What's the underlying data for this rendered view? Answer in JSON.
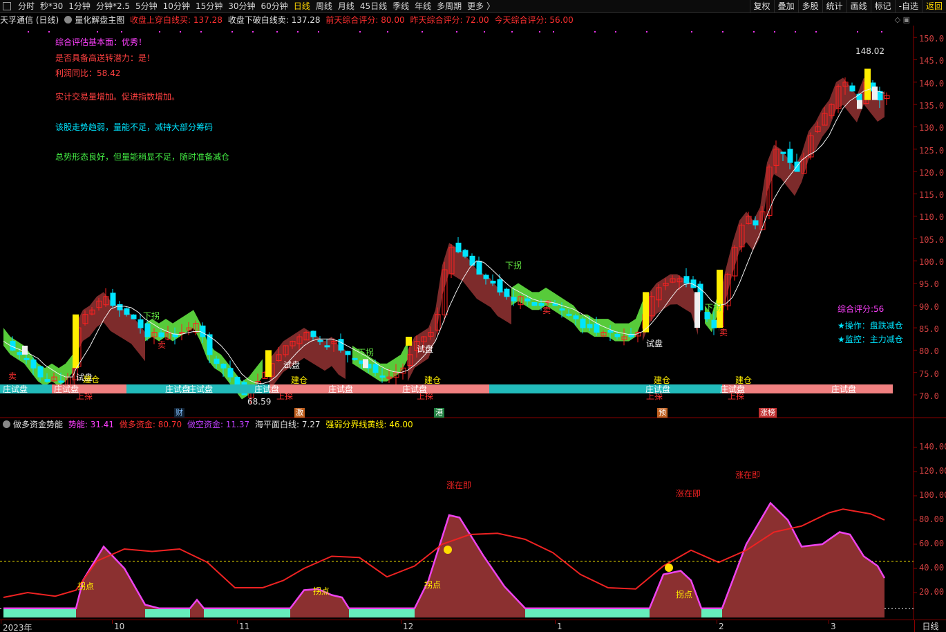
{
  "toolbar": {
    "periods": [
      "分时",
      "秒*30",
      "1分钟",
      "分钟*2.5",
      "5分钟",
      "10分钟",
      "15分钟",
      "30分钟",
      "60分钟",
      "日线",
      "周线",
      "月线",
      "45日线",
      "季线",
      "年线",
      "多周期",
      "更多 〉"
    ],
    "active_period": "日线",
    "tools": [
      "复权",
      "叠加",
      "多股",
      "统计",
      "画线",
      "标记",
      "-自选",
      "返回"
    ]
  },
  "info_bar": {
    "stock": "天孚通信 (日线)",
    "indicator": "量化解盘主图",
    "item1": "收盘上穿白线买: 137.28",
    "item2": "收盘下破白线卖: 137.28",
    "item3": "前天综合评分: 80.00",
    "item4": "昨天综合评分: 72.00",
    "item5": "今天综合评分: 56.00"
  },
  "analysis": {
    "line1": "综合评估基本面：优秀！",
    "line2": "是否具备高送转潜力：是！",
    "line3": "利润同比：58.42",
    "line4": "实计交易量增加。促进指数增加。",
    "line5": "该股走势趋弱，量能不足，减持大部分筹码",
    "line6": "总势形态良好，但量能稍显不足，随时准备减仓"
  },
  "right_panel": {
    "score": "综合评分:56",
    "op": "★操作：盘跌减仓",
    "monitor": "★监控：主力减仓"
  },
  "price_axis": [
    "150.0",
    "145.0",
    "140.0",
    "135.0",
    "130.0",
    "125.0",
    "120.0",
    "115.0",
    "110.0",
    "105.0",
    "100.0",
    "95.0",
    "90.0",
    "85.0",
    "80.0",
    "75.0",
    "70.0"
  ],
  "price_marks": {
    "high": "148.02",
    "low": "68.59"
  },
  "chart_labels": {
    "shipan": "试盘",
    "jiancang": "建仓",
    "xiaguai": "下拐",
    "shangtan": "上探",
    "mai": "卖",
    "zhuang": "庄试盘"
  },
  "badges": [
    "财",
    "激",
    "港",
    "预",
    "涨榜"
  ],
  "indicator_bar": {
    "name": "做多资金势能",
    "energy": "势能: 31.41",
    "long": "做多资金: 80.70",
    "short": "做空资金: 11.37",
    "sea": "海平面白线: 7.27",
    "divider": "强弱分界线黄线: 46.00"
  },
  "ind_axis": [
    "140.00",
    "120.00",
    "100.00",
    "80.00",
    "60.00",
    "40.00",
    "20.00"
  ],
  "ind_labels": {
    "zaiji": "涨在即",
    "guaidian": "拐点"
  },
  "time_axis": [
    "2023年",
    "10",
    "11",
    "12",
    "1",
    "2",
    "3"
  ],
  "day_line": "日线",
  "colors": {
    "up": "#ff2020",
    "down": "#00e5ff",
    "band_green": "#66ee66",
    "band_brown": "#8b3030",
    "energy": "#ee44ee",
    "yellow": "#ffee00"
  }
}
